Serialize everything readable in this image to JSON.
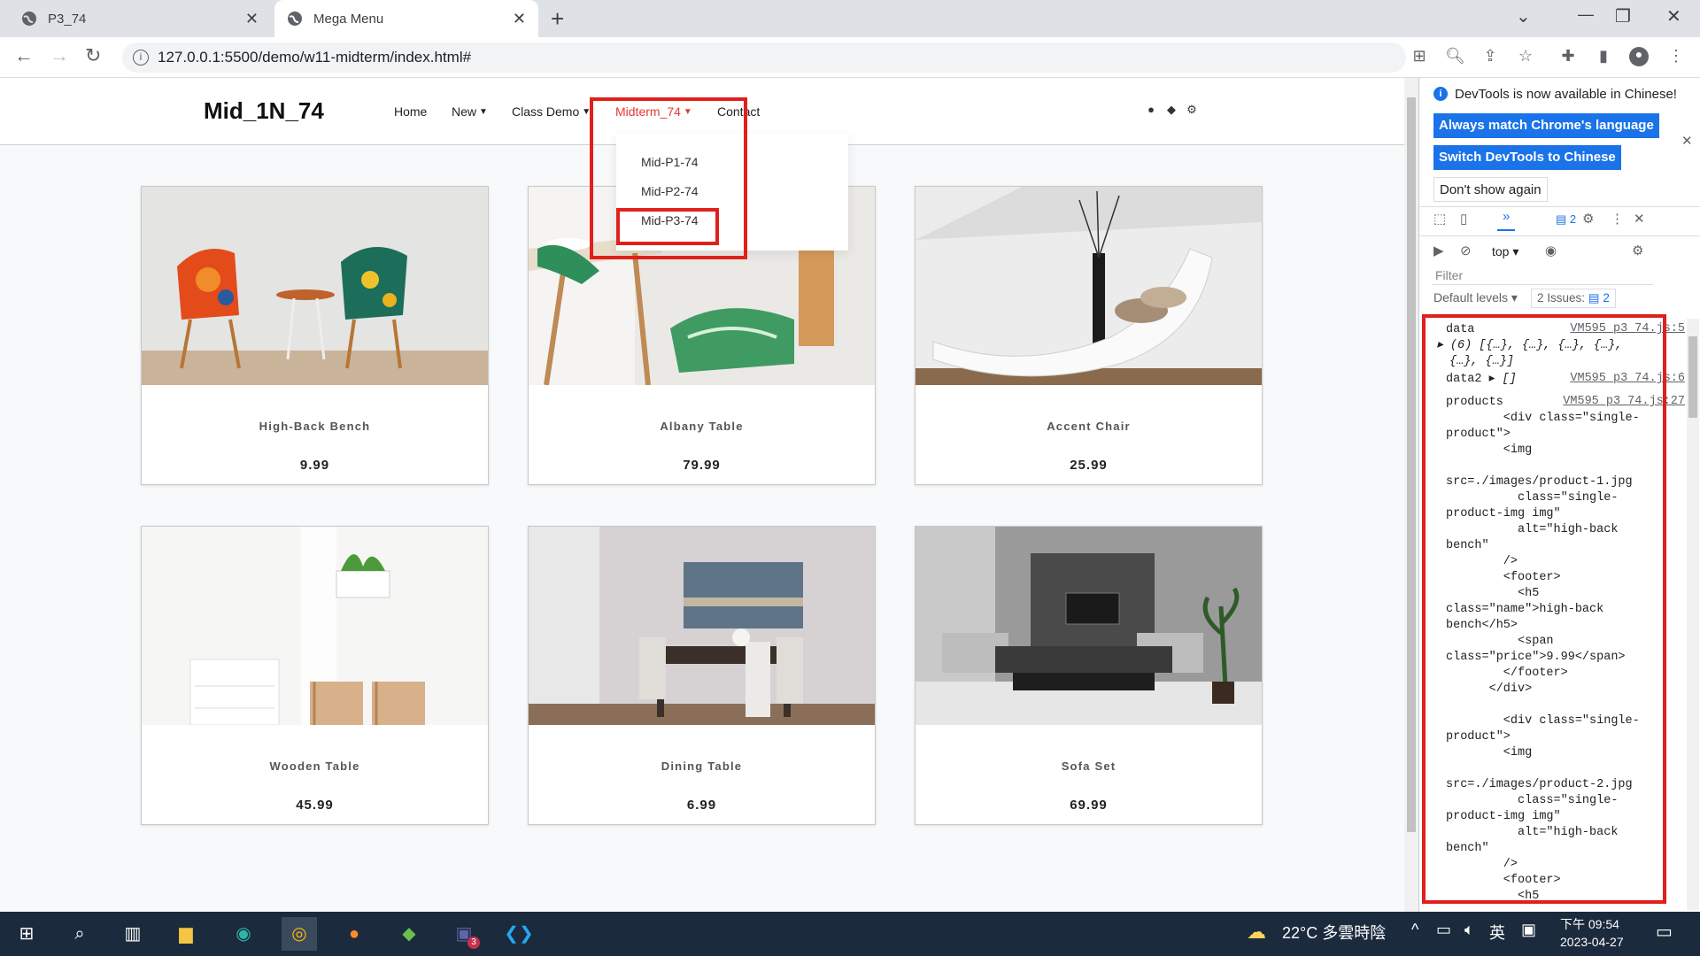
{
  "browser": {
    "tabs": [
      {
        "title": "P3_74"
      },
      {
        "title": "Mega Menu"
      }
    ],
    "url": "127.0.0.1:5500/demo/w11-midterm/index.html#"
  },
  "site": {
    "brand": "Mid_1N_74",
    "nav": [
      {
        "label": "Home",
        "chevron": false
      },
      {
        "label": "New",
        "chevron": true
      },
      {
        "label": "Class Demo",
        "chevron": true
      },
      {
        "label": "Midterm_74",
        "chevron": true,
        "active": true
      },
      {
        "label": "Contact",
        "chevron": false
      }
    ],
    "dropdown": [
      "Mid-P1-74",
      "Mid-P2-74",
      "Mid-P3-74"
    ],
    "products": [
      {
        "name": "High-Back Bench",
        "price": "9.99"
      },
      {
        "name": "Albany Table",
        "price": "79.99"
      },
      {
        "name": "Accent Chair",
        "price": "25.99"
      },
      {
        "name": "Wooden Table",
        "price": "45.99"
      },
      {
        "name": "Dining Table",
        "price": "6.99"
      },
      {
        "name": "Sofa Set",
        "price": "69.99"
      }
    ],
    "accent_color": "#e53935",
    "highlight_color": "#e0201b"
  },
  "devtools": {
    "notice": "DevTools is now available in Chinese!",
    "btn_match": "Always match Chrome's language",
    "btn_switch": "Switch DevTools to Chinese",
    "btn_dont": "Don't show again",
    "messages_count": "2",
    "context": "top",
    "filter_placeholder": "Filter",
    "levels": "Default levels",
    "issues": "2 Issues:",
    "issues_count": "2",
    "console": {
      "data_label": "data",
      "data_src": "VM595 p3_74.js:5",
      "data_value_1": "(6) [{…}, {…}, {…}, {…},",
      "data_value_2": "{…}, {…}]",
      "data2_label": "data2",
      "data2_value": "[]",
      "data2_src": "VM595 p3_74.js:6",
      "products_label": "products",
      "products_src": "VM595 p3_74.js:27",
      "lines": [
        "        <div class=\"single-",
        "product\">",
        "        <img",
        "",
        "src=./images/product-1.jpg",
        "          class=\"single-",
        "product-img img\"",
        "          alt=\"high-back",
        "bench\"",
        "        />",
        "        <footer>",
        "          <h5",
        "class=\"name\">high-back",
        "bench</h5>",
        "          <span",
        "class=\"price\">9.99</span>",
        "        </footer>",
        "      </div>",
        "",
        "        <div class=\"single-",
        "product\">",
        "        <img",
        "",
        "src=./images/product-2.jpg",
        "          class=\"single-",
        "product-img img\"",
        "          alt=\"high-back",
        "bench\"",
        "        />",
        "        <footer>",
        "          <h5"
      ]
    }
  },
  "taskbar": {
    "weather": "22°C 多雲時陰",
    "ime": "英",
    "time": "下午 09:54",
    "date": "2023-04-27",
    "teams_badge": "3"
  }
}
